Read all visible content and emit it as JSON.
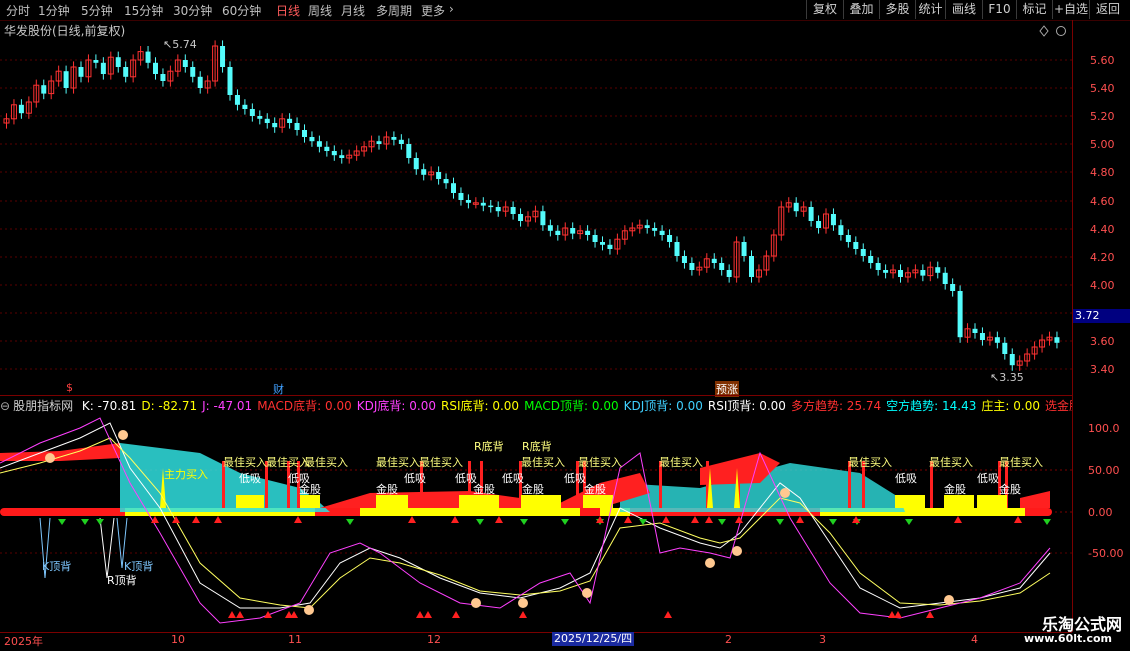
{
  "toolbar": {
    "periods": [
      "分时",
      "1分钟",
      "5分钟",
      "15分钟",
      "30分钟",
      "60分钟",
      "日线",
      "周线",
      "月线",
      "多周期",
      "更多"
    ],
    "active_period": "日线",
    "more_arrow": "›",
    "buttons": [
      "复权",
      "叠加",
      "多股",
      "统计",
      "画线",
      "F10",
      "标记",
      "+自选",
      "返回"
    ]
  },
  "main_panel": {
    "title": "华发股份(日线,前复权)",
    "high_label": "5.74",
    "low_label": "3.35",
    "current_price": "3.72",
    "y_ticks": [
      "5.60",
      "5.40",
      "5.20",
      "5.00",
      "4.80",
      "4.60",
      "4.40",
      "4.20",
      "4.00",
      "3.60",
      "3.40"
    ],
    "events": {
      "dollar": "$",
      "cai": "财",
      "yuzhang": "预涨"
    },
    "corner_icons": [
      "diamond-icon",
      "circle-icon"
    ]
  },
  "indicator_panel": {
    "name": "股朋指标网",
    "items": [
      {
        "text": "K: -70.81",
        "color": "#ffffff"
      },
      {
        "text": "D: -82.71",
        "color": "#ffff00"
      },
      {
        "text": "J: -47.01",
        "color": "#ff40ff"
      },
      {
        "text": "MACD底背: 0.00",
        "color": "#ff3030"
      },
      {
        "text": "KDJ底背: 0.00",
        "color": "#ff40ff"
      },
      {
        "text": "RSI底背: 0.00",
        "color": "#ffff00"
      },
      {
        "text": "MACD顶背: 0.00",
        "color": "#00ff00"
      },
      {
        "text": "KDJ顶背: 0.00",
        "color": "#40d0ff"
      },
      {
        "text": "RSI顶背: 0.00",
        "color": "#ffffff"
      },
      {
        "text": "多方趋势: 25.74",
        "color": "#ff3030"
      },
      {
        "text": "空方趋势: 14.43",
        "color": "#00ffff"
      },
      {
        "text": "庄主: 0.00",
        "color": "#ffff00"
      },
      {
        "text": "选金股: 0.00",
        "color": "#ff3030"
      },
      {
        "text": "最",
        "color": "#ff3030"
      }
    ],
    "y_ticks": [
      "100.0",
      "50.00",
      "0.00",
      "-50.00"
    ],
    "labels": {
      "best_buy": "最佳买入",
      "low_buy": "低吸",
      "golden": "金股",
      "k_top": "K顶背",
      "r_top": "R顶背",
      "r_bottom": "R底背",
      "main_buy": "主力买入"
    }
  },
  "x_axis": {
    "labels": [
      "2025年",
      "10",
      "11",
      "12",
      "2",
      "3",
      "4"
    ],
    "selected_date": "2025/12/25/四"
  },
  "watermark": {
    "name": "乐淘公式网",
    "url": "www.60lt.com"
  }
}
